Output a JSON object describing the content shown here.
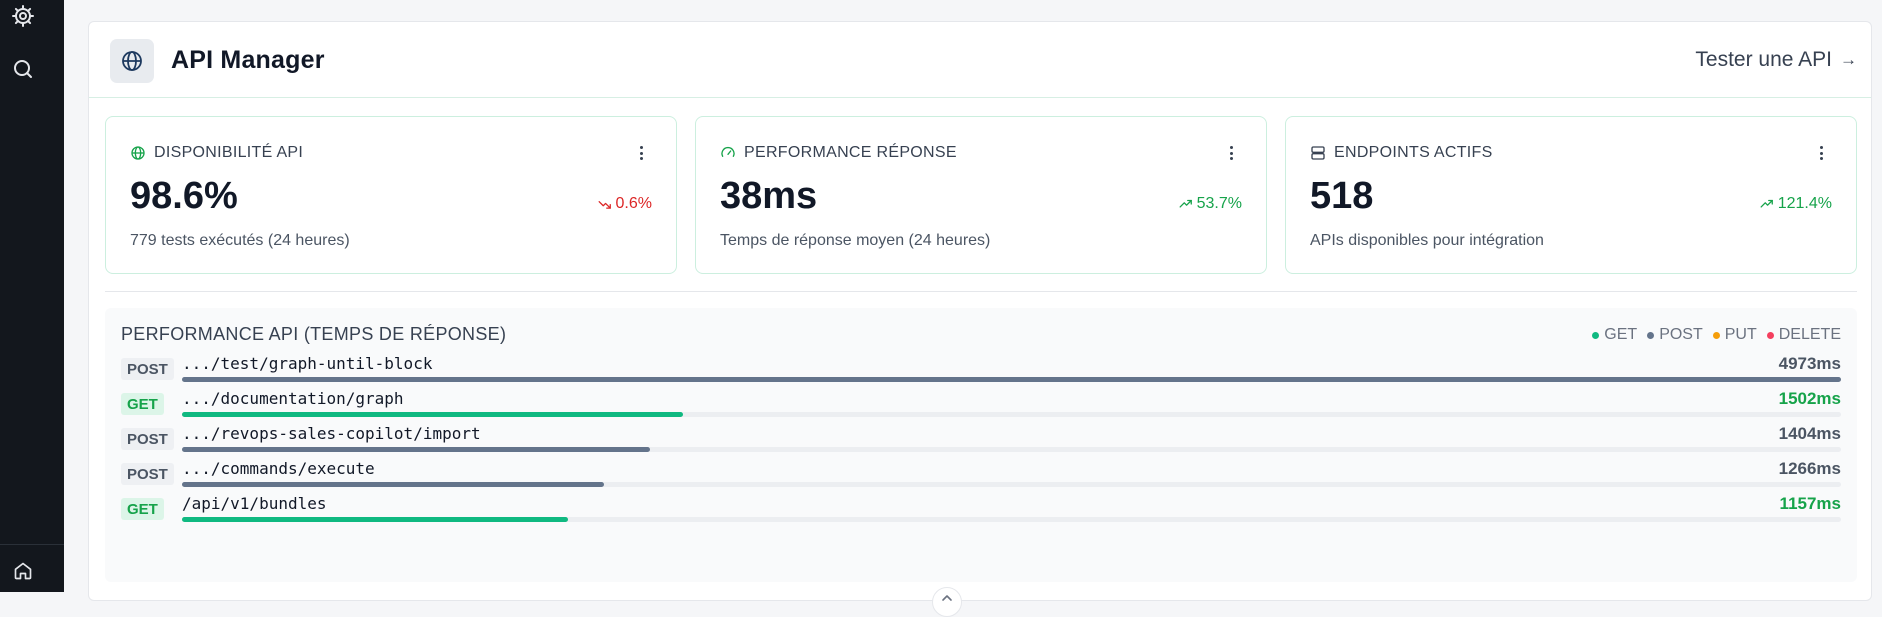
{
  "sidebar": {
    "icons": [
      "gear-icon",
      "search-icon",
      "home-icon"
    ]
  },
  "header": {
    "title": "API Manager",
    "test_link": "Tester une API",
    "test_link_arrow": "→",
    "logo_icon": "globe-icon"
  },
  "cards": [
    {
      "icon": "globe-icon",
      "label": "DISPONIBILITÉ API",
      "value": "98.6%",
      "trend": "0.6%",
      "trend_direction": "down",
      "subtitle": "779 tests exécutés (24 heures)"
    },
    {
      "icon": "gauge-icon",
      "label": "PERFORMANCE RÉPONSE",
      "value": "38ms",
      "trend": "53.7%",
      "trend_direction": "up",
      "subtitle": "Temps de réponse moyen (24 heures)"
    },
    {
      "icon": "server-icon",
      "label": "ENDPOINTS ACTIFS",
      "value": "518",
      "trend": "121.4%",
      "trend_direction": "up",
      "subtitle": "APIs disponibles pour intégration"
    }
  ],
  "performance": {
    "title": "PERFORMANCE API (TEMPS DE RÉPONSE)",
    "legend": [
      {
        "label": "GET",
        "color": "#10b981"
      },
      {
        "label": "POST",
        "color": "#64748b"
      },
      {
        "label": "PUT",
        "color": "#f59e0b"
      },
      {
        "label": "DELETE",
        "color": "#f43f5e"
      }
    ],
    "max_ms": 4973,
    "rows": [
      {
        "method": "POST",
        "path": ".../test/graph-until-block",
        "ms": 4973,
        "label": "4973ms"
      },
      {
        "method": "GET",
        "path": ".../documentation/graph",
        "ms": 1502,
        "label": "1502ms"
      },
      {
        "method": "POST",
        "path": ".../revops-sales-copilot/import",
        "ms": 1404,
        "label": "1404ms"
      },
      {
        "method": "POST",
        "path": ".../commands/execute",
        "ms": 1266,
        "label": "1266ms"
      },
      {
        "method": "GET",
        "path": "/api/v1/bundles",
        "ms": 1157,
        "label": "1157ms"
      }
    ]
  },
  "colors": {
    "accent_green": "#10b981",
    "post_gray": "#64748b",
    "trend_down": "#dc2626",
    "trend_up": "#16a34a"
  }
}
